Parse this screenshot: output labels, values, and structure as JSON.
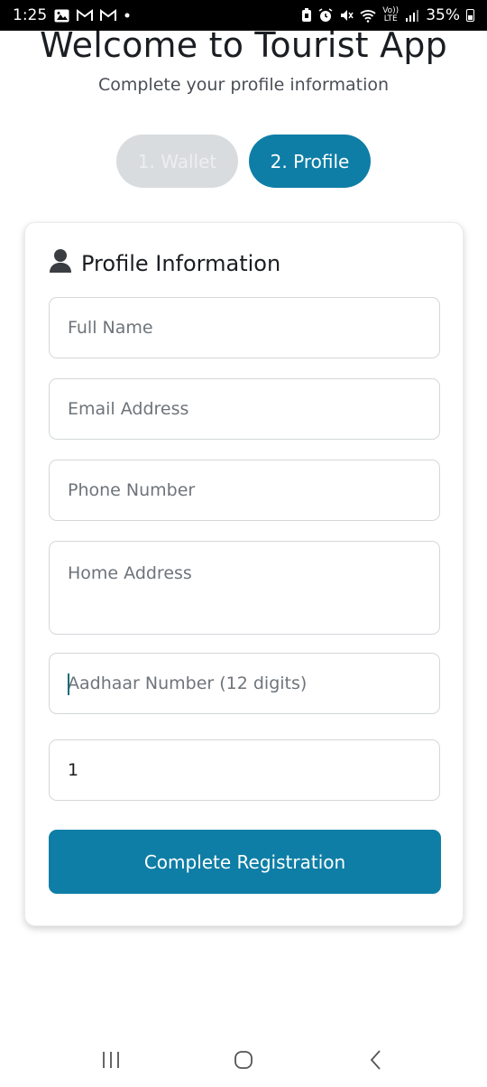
{
  "status_bar": {
    "time": "1:25",
    "notification_icons": [
      "image-icon",
      "gmail-icon",
      "gmail-icon",
      "dot-icon"
    ],
    "carrier_label": "Vo)) LTE",
    "battery_percent": "35%"
  },
  "header": {
    "title": "Welcome to Tourist App",
    "subtitle": "Complete your profile information"
  },
  "steps": [
    {
      "label": "1. Wallet",
      "active": false
    },
    {
      "label": "2. Profile",
      "active": true
    }
  ],
  "profile_card": {
    "title": "Profile Information",
    "title_icon": "person-icon",
    "fields": {
      "full_name": {
        "placeholder": "Full Name",
        "value": ""
      },
      "email": {
        "placeholder": "Email Address",
        "value": ""
      },
      "phone": {
        "placeholder": "Phone Number",
        "value": ""
      },
      "home_address": {
        "placeholder": "Home Address",
        "value": ""
      },
      "aadhaar": {
        "placeholder": "Aadhaar Number (12 digits)",
        "value": ""
      },
      "extra": {
        "placeholder": "",
        "value": "1"
      }
    },
    "submit_label": "Complete Registration"
  },
  "colors": {
    "accent": "#0e7ea6",
    "inactive_step": "#d9dcdf",
    "field_border": "#d4d7da"
  }
}
